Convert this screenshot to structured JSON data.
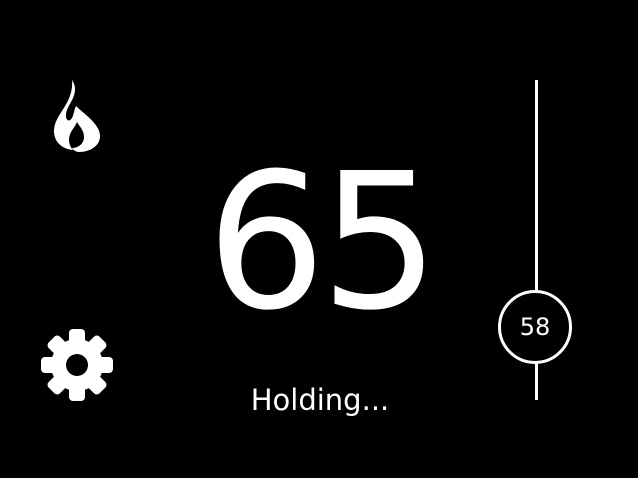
{
  "icons": {
    "mode": "flame-icon",
    "settings": "gear-icon"
  },
  "thermostat": {
    "current_temperature": "65",
    "status": "Holding...",
    "setpoint": "58"
  },
  "colors": {
    "background": "#000000",
    "foreground": "#ffffff"
  }
}
